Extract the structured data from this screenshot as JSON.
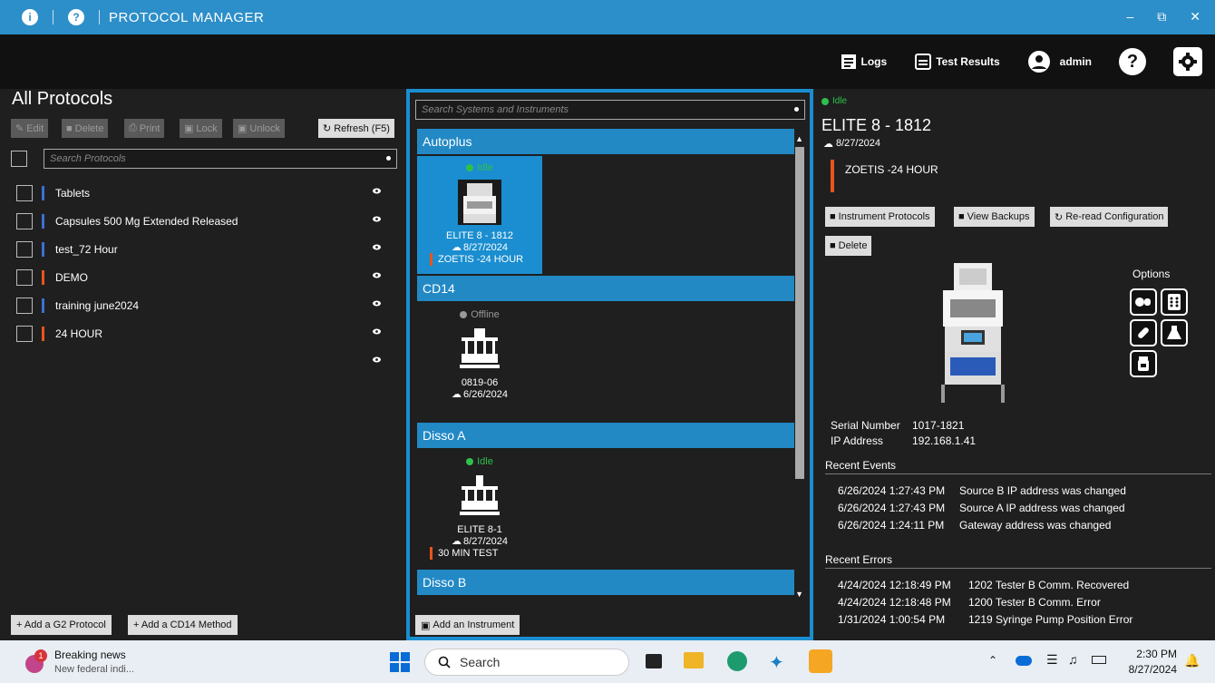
{
  "app": {
    "title": "PROTOCOL MANAGER",
    "accent": "#2d8fc9"
  },
  "toolbar": {
    "logs": "Logs",
    "test_results": "Test Results",
    "user": "admin",
    "help": "?"
  },
  "protocols": {
    "title": "All Protocols",
    "edit": "Edit",
    "delete": "Delete",
    "print": "Print",
    "lock": "Lock",
    "unlock": "Unlock",
    "refresh": "Refresh (F5)",
    "search_placeholder": "Search Protocols",
    "items": [
      {
        "name": "Tablets",
        "color": "#3a6fd8"
      },
      {
        "name": "Capsules 500 Mg Extended Released",
        "color": "#3a6fd8"
      },
      {
        "name": "test_72 Hour",
        "color": "#3a6fd8"
      },
      {
        "name": "DEMO",
        "color": "#e8541c"
      },
      {
        "name": "training june2024",
        "color": "#3a6fd8"
      },
      {
        "name": "24 HOUR",
        "color": "#e8541c"
      }
    ],
    "add_g2": "+ Add a G2 Protocol",
    "add_cd14": "+ Add a CD14 Method"
  },
  "systems": {
    "search_placeholder": "Search Systems and Instruments",
    "groups": [
      {
        "name": "Autoplus",
        "instrument": {
          "status": "Idle",
          "name": "ELITE 8 - 1812",
          "date": "8/27/2024",
          "protocol": "ZOETIS -24 HOUR"
        }
      },
      {
        "name": "CD14",
        "instrument": {
          "status": "Offline",
          "name": "0819-06",
          "date": "6/26/2024",
          "protocol": ""
        }
      },
      {
        "name": "Disso A",
        "instrument": {
          "status": "Idle",
          "name": "ELITE 8-1",
          "date": "8/27/2024",
          "protocol": "30 MIN TEST"
        }
      },
      {
        "name": "Disso B"
      }
    ],
    "add_instrument": "Add an Instrument"
  },
  "detail": {
    "status": "Idle",
    "name": "ELITE 8 - 1812",
    "date": "8/27/2024",
    "protocol": "ZOETIS -24 HOUR",
    "buttons": {
      "instrument_protocols": "Instrument Protocols",
      "view_backups": "View Backups",
      "reread": "Re-read Configuration",
      "delete": "Delete"
    },
    "options_label": "Options",
    "serial_label": "Serial Number",
    "serial": "1017-1821",
    "ip_label": "IP Address",
    "ip": "192.168.1.41",
    "recent_events_label": "Recent Events",
    "events": [
      {
        "time": "6/26/2024 1:27:43 PM",
        "text": "Source B IP address was changed"
      },
      {
        "time": "6/26/2024 1:27:43 PM",
        "text": "Source A IP address was changed"
      },
      {
        "time": "6/26/2024 1:24:11 PM",
        "text": "Gateway address was changed"
      }
    ],
    "recent_errors_label": "Recent Errors",
    "errors": [
      {
        "time": "4/24/2024 12:18:49 PM",
        "text": "1202 Tester B Comm. Recovered"
      },
      {
        "time": "4/24/2024 12:18:48 PM",
        "text": "1200 Tester B Comm. Error"
      },
      {
        "time": "1/31/2024 1:00:54 PM",
        "text": "1219 Syringe Pump Position Error"
      }
    ]
  },
  "taskbar": {
    "news_badge": "1",
    "news_title": "Breaking news",
    "news_sub": "New federal indi...",
    "search": "Search",
    "time": "2:30 PM",
    "date": "8/27/2024"
  }
}
